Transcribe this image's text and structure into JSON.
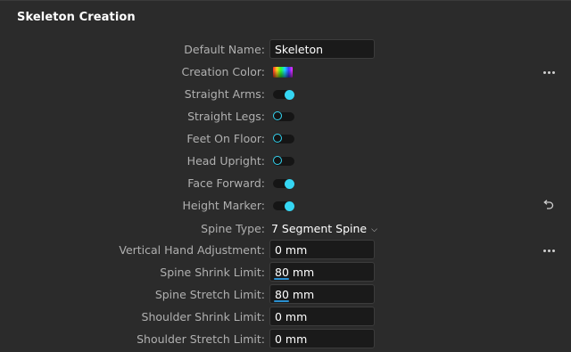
{
  "panel": {
    "title": "Skeleton Creation"
  },
  "colors": {
    "accent": "#35d6f3",
    "background": "#2b2b2b",
    "field_bg": "#1a1a1a"
  },
  "rows": {
    "default_name": {
      "label": "Default Name:",
      "value": "Skeleton"
    },
    "creation_color": {
      "label": "Creation Color:",
      "value_icon": "rainbow-color-swatch"
    },
    "straight_arms": {
      "label": "Straight Arms:",
      "on": true
    },
    "straight_legs": {
      "label": "Straight Legs:",
      "on": false
    },
    "feet_on_floor": {
      "label": "Feet On Floor:",
      "on": false
    },
    "head_upright": {
      "label": "Head Upright:",
      "on": false
    },
    "face_forward": {
      "label": "Face Forward:",
      "on": true
    },
    "height_marker": {
      "label": "Height Marker:",
      "on": true
    },
    "spine_type": {
      "label": "Spine Type:",
      "value": "7 Segment Spine"
    },
    "vertical_hand_adjustment": {
      "label": "Vertical Hand Adjustment:",
      "value": "0 mm"
    },
    "spine_shrink_limit": {
      "label": "Spine Shrink Limit:",
      "value": "80 mm"
    },
    "spine_stretch_limit": {
      "label": "Spine Stretch Limit:",
      "value": "80 mm"
    },
    "shoulder_shrink_limit": {
      "label": "Shoulder Shrink Limit:",
      "value": "0 mm"
    },
    "shoulder_stretch_limit": {
      "label": "Shoulder Stretch Limit:",
      "value": "0 mm"
    }
  },
  "icons": {
    "more": "more-horizontal-icon",
    "reset": "reset-icon",
    "dropdown": "chevron-down-icon"
  }
}
